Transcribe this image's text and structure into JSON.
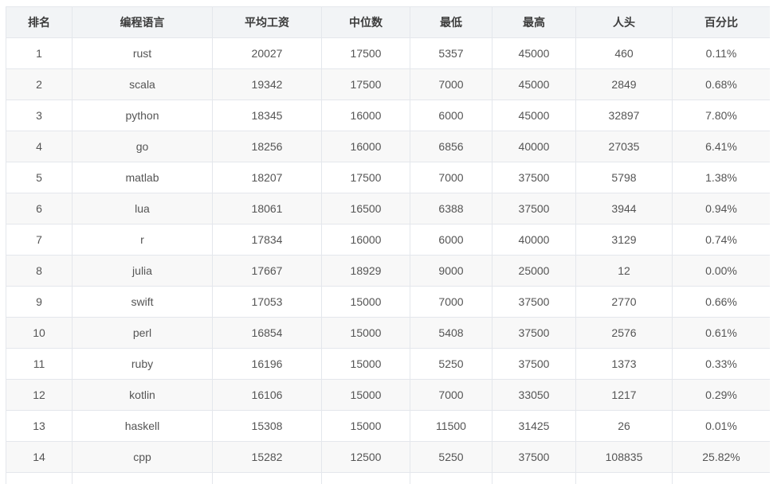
{
  "table": {
    "headers": [
      "排名",
      "编程语言",
      "平均工资",
      "中位数",
      "最低",
      "最高",
      "人头",
      "百分比"
    ],
    "rows": [
      [
        "1",
        "rust",
        "20027",
        "17500",
        "5357",
        "45000",
        "460",
        "0.11%"
      ],
      [
        "2",
        "scala",
        "19342",
        "17500",
        "7000",
        "45000",
        "2849",
        "0.68%"
      ],
      [
        "3",
        "python",
        "18345",
        "16000",
        "6000",
        "45000",
        "32897",
        "7.80%"
      ],
      [
        "4",
        "go",
        "18256",
        "16000",
        "6856",
        "40000",
        "27035",
        "6.41%"
      ],
      [
        "5",
        "matlab",
        "18207",
        "17500",
        "7000",
        "37500",
        "5798",
        "1.38%"
      ],
      [
        "6",
        "lua",
        "18061",
        "16500",
        "6388",
        "37500",
        "3944",
        "0.94%"
      ],
      [
        "7",
        "r",
        "17834",
        "16000",
        "6000",
        "40000",
        "3129",
        "0.74%"
      ],
      [
        "8",
        "julia",
        "17667",
        "18929",
        "9000",
        "25000",
        "12",
        "0.00%"
      ],
      [
        "9",
        "swift",
        "17053",
        "15000",
        "7000",
        "37500",
        "2770",
        "0.66%"
      ],
      [
        "10",
        "perl",
        "16854",
        "15000",
        "5408",
        "37500",
        "2576",
        "0.61%"
      ],
      [
        "11",
        "ruby",
        "16196",
        "15000",
        "5250",
        "37500",
        "1373",
        "0.33%"
      ],
      [
        "12",
        "kotlin",
        "16106",
        "15000",
        "7000",
        "33050",
        "1217",
        "0.29%"
      ],
      [
        "13",
        "haskell",
        "15308",
        "15000",
        "11500",
        "31425",
        "26",
        "0.01%"
      ],
      [
        "14",
        "cpp",
        "15282",
        "12500",
        "5250",
        "37500",
        "108835",
        "25.82%"
      ],
      [
        "",
        "",
        "",
        "",
        "",
        "",
        "",
        ""
      ]
    ]
  }
}
